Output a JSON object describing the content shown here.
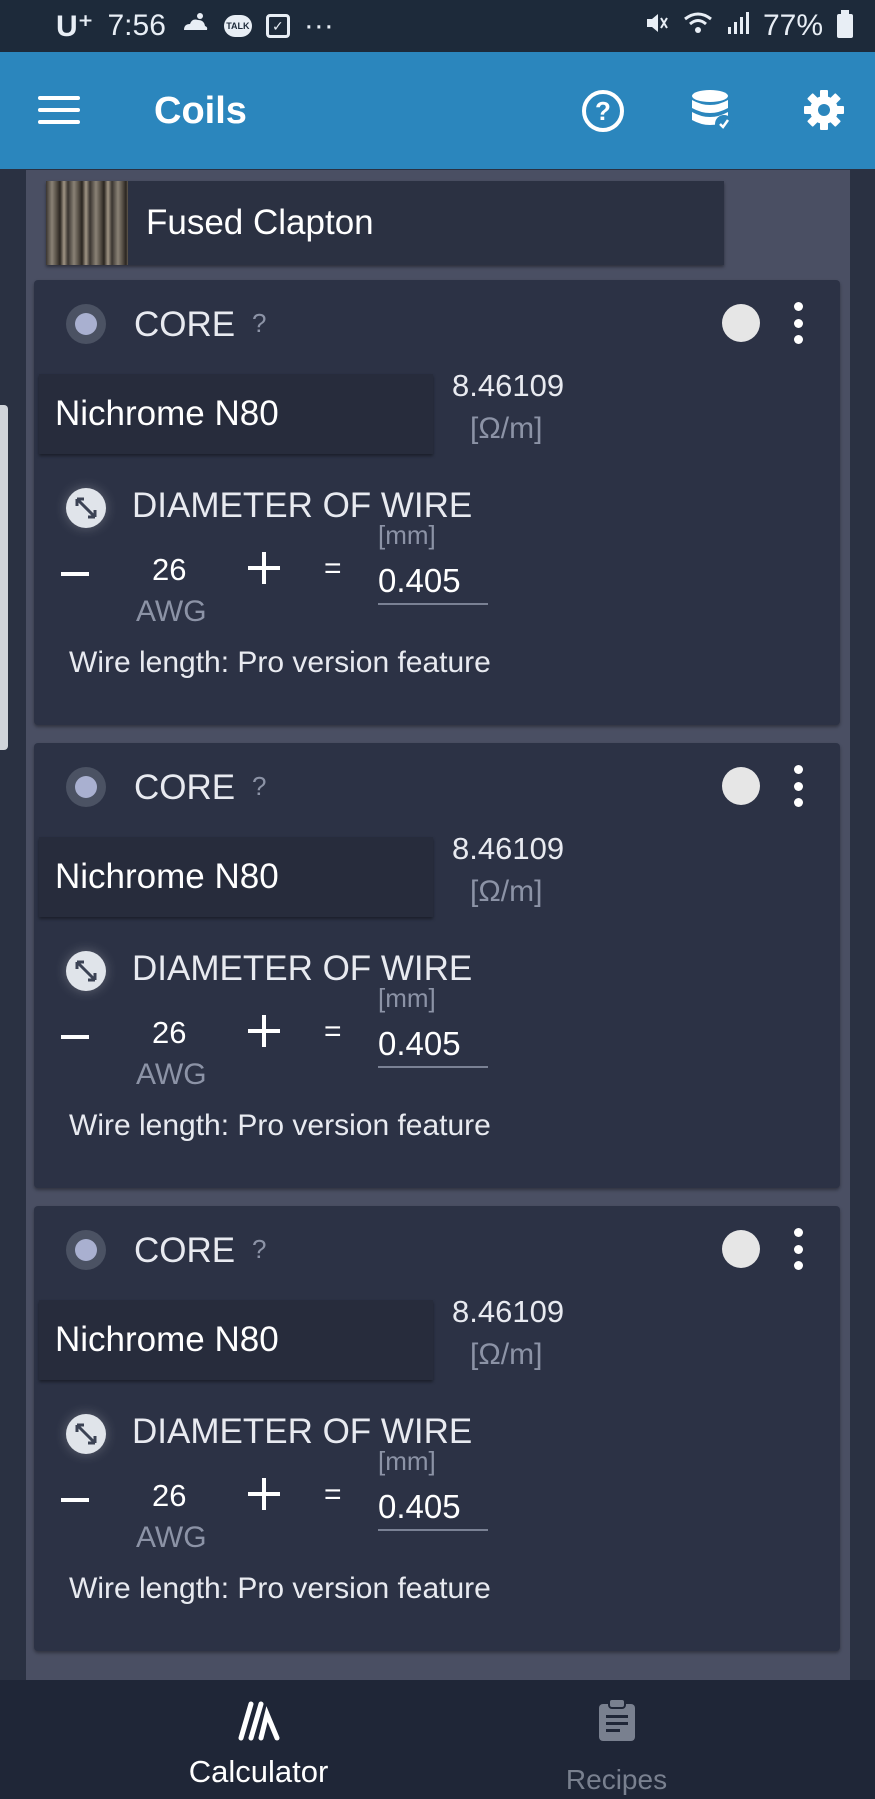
{
  "status_bar": {
    "carrier": "U⁺",
    "time": "7:56",
    "talk": "TALK",
    "more": "···",
    "battery_pct": "77%"
  },
  "app_bar": {
    "title": "Coils",
    "help_glyph": "?"
  },
  "coil_type": "Fused Clapton",
  "wires": [
    {
      "label": "CORE",
      "help": "?",
      "material": "Nichrome N80",
      "resistance": "8.46109",
      "resistance_unit": "[Ω/m]",
      "diameter_label": "DIAMETER OF WIRE",
      "gauge": "26",
      "gauge_unit": "AWG",
      "equals": "=",
      "mm_unit": "[mm]",
      "mm_value": "0.405",
      "wire_length": "Wire length: Pro version feature"
    },
    {
      "label": "CORE",
      "help": "?",
      "material": "Nichrome N80",
      "resistance": "8.46109",
      "resistance_unit": "[Ω/m]",
      "diameter_label": "DIAMETER OF WIRE",
      "gauge": "26",
      "gauge_unit": "AWG",
      "equals": "=",
      "mm_unit": "[mm]",
      "mm_value": "0.405",
      "wire_length": "Wire length: Pro version feature"
    },
    {
      "label": "CORE",
      "help": "?",
      "material": "Nichrome N80",
      "resistance": "8.46109",
      "resistance_unit": "[Ω/m]",
      "diameter_label": "DIAMETER OF WIRE",
      "gauge": "26",
      "gauge_unit": "AWG",
      "equals": "=",
      "mm_unit": "[mm]",
      "mm_value": "0.405",
      "wire_length": "Wire length: Pro version feature"
    }
  ],
  "bottom_nav": {
    "calculator": "Calculator",
    "recipes": "Recipes"
  },
  "icons": {
    "menu": "hamburger-menu-icon",
    "help": "help-circle-icon",
    "database": "database-icon",
    "settings": "gear-icon",
    "diameter": "diameter-icon",
    "calculator": "calculator-icon",
    "recipes": "clipboard-icon"
  },
  "colors": {
    "app_bar": "#2b86bd",
    "status_bar": "#1d2a3a",
    "background": "#2a3142",
    "card": "#2c3245",
    "accent_radio": "#a9b0d0"
  }
}
